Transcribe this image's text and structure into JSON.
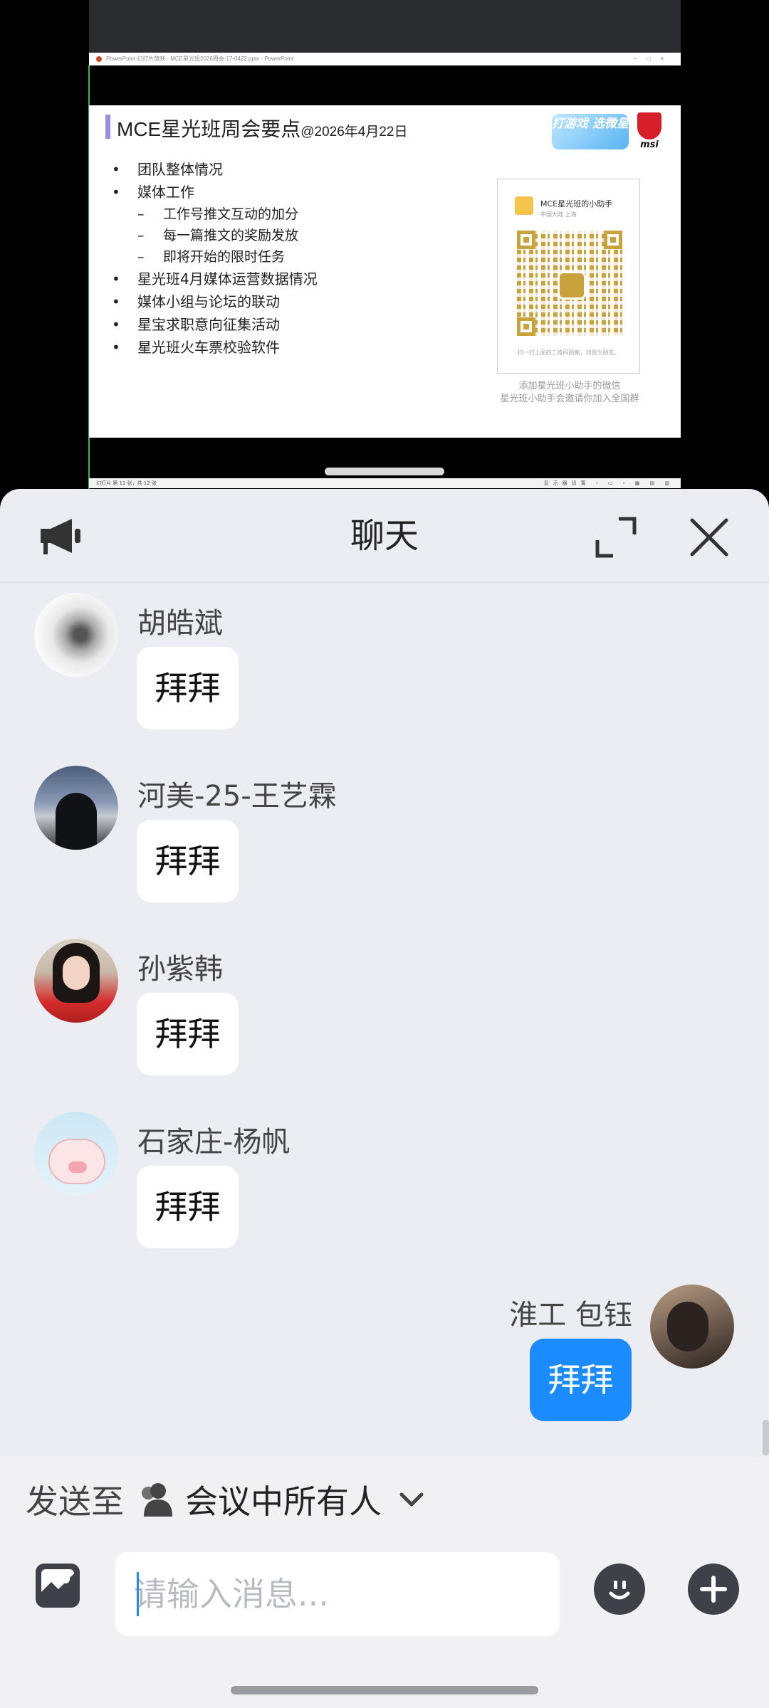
{
  "shared_screen": {
    "ppt_window_title": "PowerPoint 幻灯片放映 - MCE星光班2026周会-17-0422.pptx - PowerPoint",
    "slide": {
      "title": "MCE星光班周会要点",
      "title_date": "@2026年4月22日",
      "bullets": [
        "团队整体情况",
        "媒体工作",
        "星光班4月媒体运营数据情况",
        "媒体小组与论坛的联动",
        "星宝求职意向征集活动",
        "星光班火车票校验软件"
      ],
      "sub_bullets": [
        "工作号推文互动的加分",
        "每一篇推文的奖励发放",
        "即将开始的限时任务"
      ],
      "game_logo_text": "打游戏 选微星",
      "brand_logo_text": "msi",
      "qr_card_name": "MCE星光班的小助手",
      "qr_card_location": "中国大陆 上海",
      "qr_card_footer": "扫一扫上面的二维码图案，加我为朋友。",
      "qr_caption_line1": "添加星光班小助手的微信",
      "qr_caption_line2": "星光班小助手会邀请你加入全国群"
    },
    "status_bar_left": "幻灯片 第 11 张，共 12 张",
    "status_bar_right": "显示器设置"
  },
  "chat": {
    "title": "聊天",
    "header_icons": {
      "left": "announcement-megaphone-icon",
      "expand": "expand-icon",
      "close": "close-icon"
    },
    "messages": [
      {
        "sender": "胡皓斌",
        "text": "拜拜",
        "mine": false
      },
      {
        "sender": "河美-25-王艺霖",
        "text": "拜拜",
        "mine": false
      },
      {
        "sender": "孙紫韩",
        "text": "拜拜",
        "mine": false
      },
      {
        "sender": "石家庄-杨帆",
        "text": "拜拜",
        "mine": false
      },
      {
        "sender": "淮工 包钰",
        "text": "拜拜",
        "mine": true
      }
    ],
    "send_to_label": "发送至",
    "send_to_target": "会议中所有人",
    "input_placeholder": "请输入消息...",
    "input_value": "",
    "colors": {
      "my_bubble": "#1a8cff",
      "panel_bg": "#ebedf3",
      "other_bubble": "#ffffff"
    }
  }
}
